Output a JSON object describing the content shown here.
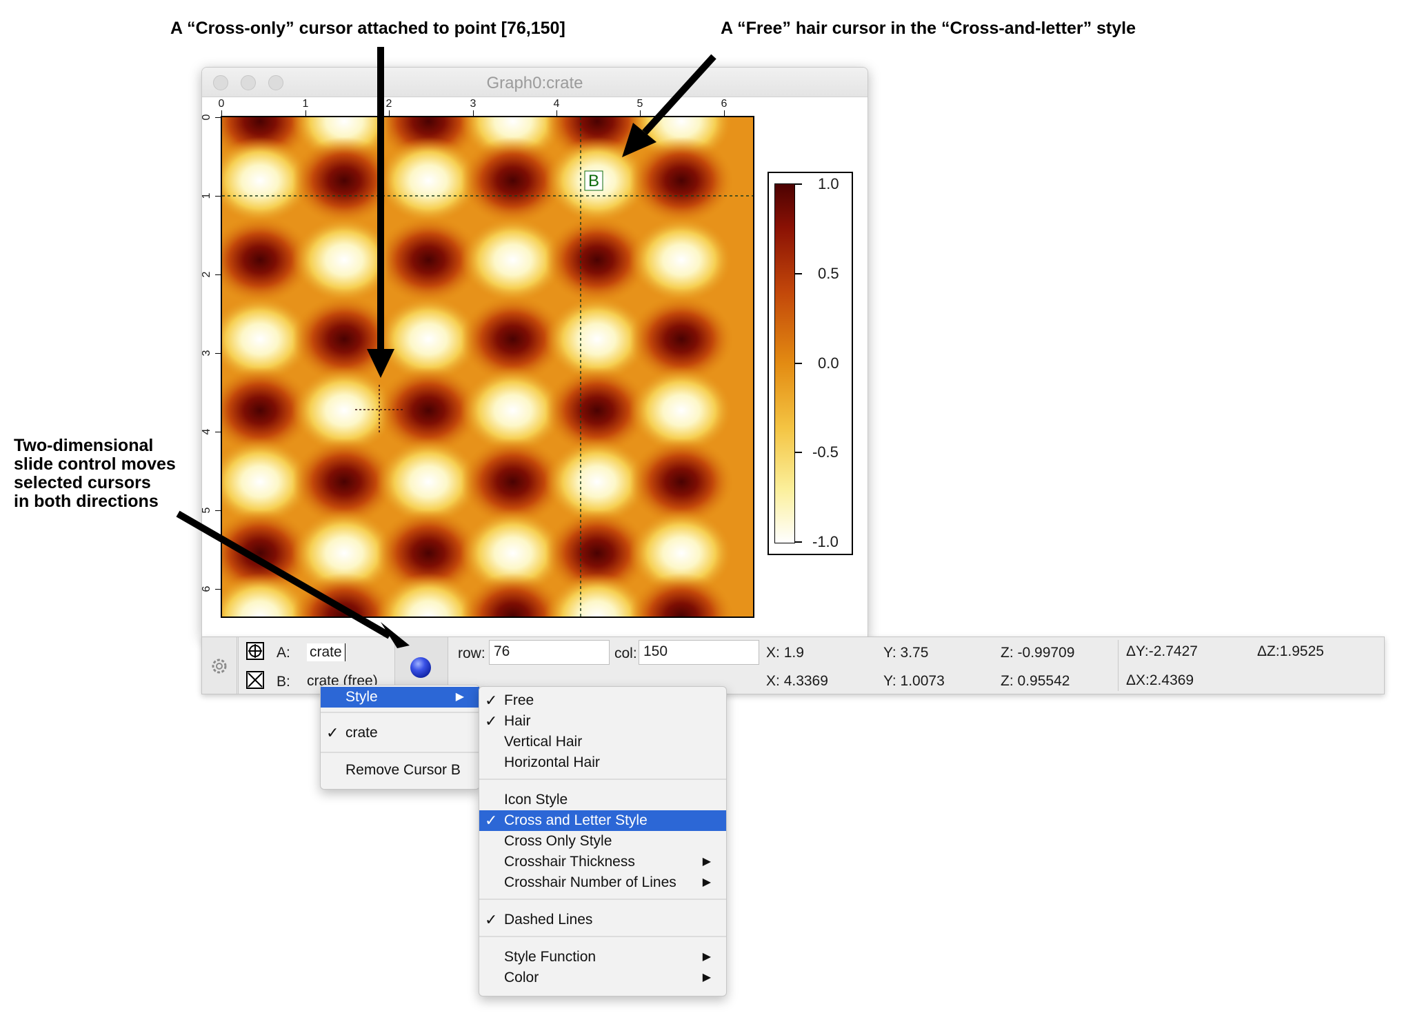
{
  "annotations": {
    "cross_only": "A “Cross-only” cursor attached to point [76,150]",
    "free_hair": "A “Free” hair cursor in the “Cross-and-letter” style",
    "slide_control": [
      "Two-dimensional",
      "slide control moves",
      "selected cursors",
      "in both directions"
    ]
  },
  "window": {
    "title": "Graph0:crate"
  },
  "plot": {
    "top_ticks": [
      "0",
      "1",
      "2",
      "3",
      "4",
      "5",
      "6"
    ],
    "left_ticks": [
      "0",
      "1",
      "2",
      "3",
      "4",
      "5",
      "6"
    ],
    "cursor_b_letter": "B",
    "colorbar_labels": [
      "1.0",
      "0.5",
      "0.0",
      "-0.5",
      "-1.0"
    ],
    "colormap_colors": [
      "#4c0202",
      "#c2470a",
      "#e38b12",
      "#fbef9a",
      "#ffffff"
    ]
  },
  "info_bar": {
    "cursor_a": {
      "label": "A:",
      "wave": "crate",
      "icon": "cross-circle-icon"
    },
    "cursor_b": {
      "label": "B:",
      "wave": "crate (free)",
      "icon": "boxed-x-icon"
    },
    "row_label": "row:",
    "row_value": "76",
    "col_label": "col:",
    "col_value": "150",
    "a_values": {
      "x_label": "X:",
      "x": "1.9",
      "y_label": "Y:",
      "y": "3.75",
      "z_label": "Z:",
      "z": "-0.99709"
    },
    "b_values": {
      "x_label": "X:",
      "x": "4.3369",
      "y_label": "Y:",
      "y": "1.0073",
      "z_label": "Z:",
      "z": "0.95542"
    },
    "deltas": {
      "dy_label": "ΔY:",
      "dy": "-2.7427",
      "dz_label": "ΔZ:",
      "dz": "1.9525",
      "dx_label": "ΔX:",
      "dx": "2.4369"
    }
  },
  "context_menu": {
    "items": [
      "Style",
      "crate",
      "Remove Cursor B"
    ],
    "style_submenu": {
      "group1": [
        "Free",
        "Hair",
        "Vertical Hair",
        "Horizontal Hair"
      ],
      "group2": [
        "Icon Style",
        "Cross and Letter Style",
        "Cross Only Style",
        "Crosshair Thickness",
        "Crosshair Number of Lines"
      ],
      "group3": [
        "Dashed Lines"
      ],
      "group4": [
        "Style Function",
        "Color"
      ]
    },
    "checked": [
      "crate",
      "Free",
      "Hair",
      "Cross and Letter Style",
      "Dashed Lines"
    ],
    "highlighted": [
      "Style",
      "Cross and Letter Style"
    ]
  }
}
